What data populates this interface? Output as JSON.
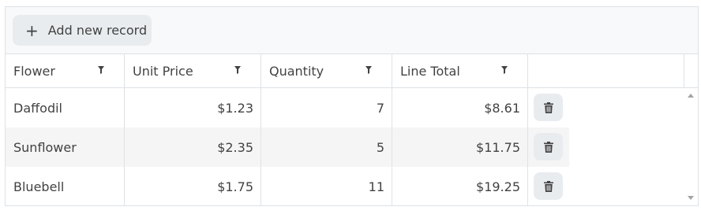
{
  "toolbar": {
    "add_icon": "plus-icon",
    "add_label": "Add new record"
  },
  "columns": [
    {
      "label": "Flower",
      "filter_icon": "filter-icon"
    },
    {
      "label": "Unit Price",
      "filter_icon": "filter-icon"
    },
    {
      "label": "Quantity",
      "filter_icon": "filter-icon"
    },
    {
      "label": "Line Total",
      "filter_icon": "filter-icon"
    }
  ],
  "rows": [
    {
      "flower": "Daffodil",
      "unit_price": "$1.23",
      "quantity": "7",
      "line_total": "$8.61",
      "action_icon": "trash-icon"
    },
    {
      "flower": "Sunflower",
      "unit_price": "$2.35",
      "quantity": "5",
      "line_total": "$11.75",
      "action_icon": "trash-icon"
    },
    {
      "flower": "Bluebell",
      "unit_price": "$1.75",
      "quantity": "11",
      "line_total": "$19.25",
      "action_icon": "trash-icon"
    }
  ],
  "colors": {
    "toolbar_bg": "#f8f9fa",
    "button_bg": "#e9ecef",
    "alt_row_bg": "#f5f5f5",
    "border": "#dee2e6",
    "text": "#424242"
  }
}
